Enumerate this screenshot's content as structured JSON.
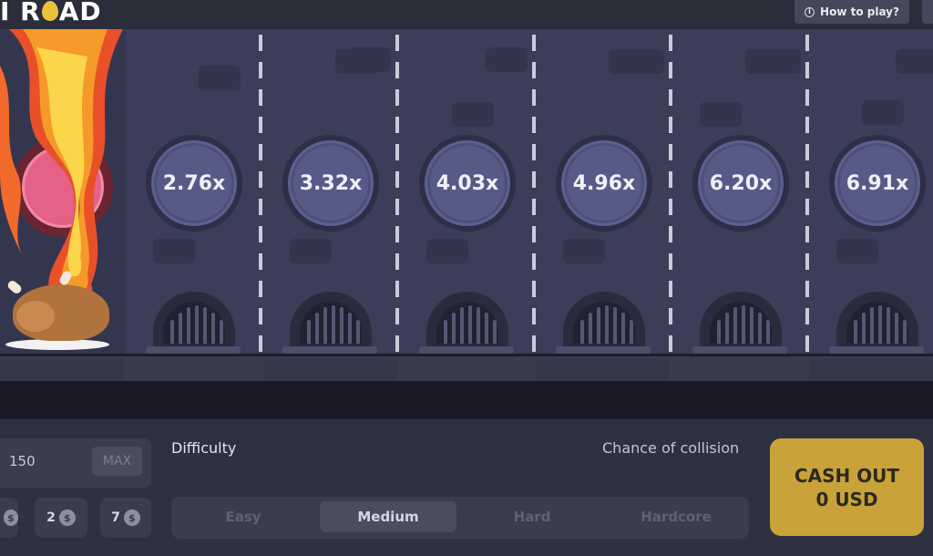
{
  "header": {
    "logo_text_a": "I R",
    "logo_text_b": "AD",
    "how_to_play": "How to play?",
    "icons": {
      "info": "info-icon"
    }
  },
  "road": {
    "lanes": [
      {
        "multiplier": "2.76x"
      },
      {
        "multiplier": "3.32x"
      },
      {
        "multiplier": "4.03x"
      },
      {
        "multiplier": "4.96x"
      },
      {
        "multiplier": "6.20x"
      },
      {
        "multiplier": "6.91x"
      }
    ],
    "start_icons": [
      "flame-icon",
      "chicken-icon",
      "plate-icon"
    ]
  },
  "bet": {
    "amount": "150",
    "max_label": "MAX",
    "chips": [
      {
        "value": "",
        "currency": "$"
      },
      {
        "value": "2",
        "currency": "$"
      },
      {
        "value": "7",
        "currency": "$"
      }
    ]
  },
  "difficulty": {
    "label": "Difficulty",
    "chance_label": "Chance of collision",
    "options": [
      "Easy",
      "Medium",
      "Hard",
      "Hardcore"
    ],
    "selected": "Medium"
  },
  "cashout": {
    "line1": "CASH OUT",
    "line2": "0 USD"
  },
  "colors": {
    "accent_gold": "#c9a23a",
    "road": "#3b3d59",
    "coin_active": "#e46188"
  }
}
